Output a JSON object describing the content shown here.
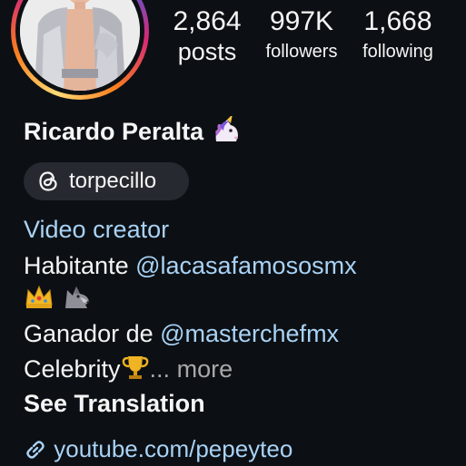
{
  "stats": {
    "posts": {
      "value": "2,864",
      "label": "posts"
    },
    "followers": {
      "value": "997K",
      "label": "followers"
    },
    "following": {
      "value": "1,668",
      "label": "following"
    }
  },
  "profile": {
    "name": "Ricardo Peralta",
    "name_emoji": "unicorn-icon",
    "threads_handle": "torpecillo"
  },
  "bio": {
    "category": "Video creator",
    "line1_prefix": "Habitante ",
    "line1_mention": "@lacasafamososmx",
    "line2_emojis": [
      "crown-icon",
      "wolf-icon"
    ],
    "line3_prefix": "Ganador de ",
    "line3_mention": "@masterchefmx",
    "line4_text": "Celebrity",
    "line4_emoji": "trophy-icon",
    "ellipsis": "...",
    "more": "more",
    "see_translation": "See Translation",
    "link": "youtube.com/pepeyteo"
  },
  "colors": {
    "background": "#0c1014",
    "text": "#f5f5f5",
    "link": "#a9d2f5",
    "muted": "#a8a8a8",
    "chip": "#262a30"
  }
}
